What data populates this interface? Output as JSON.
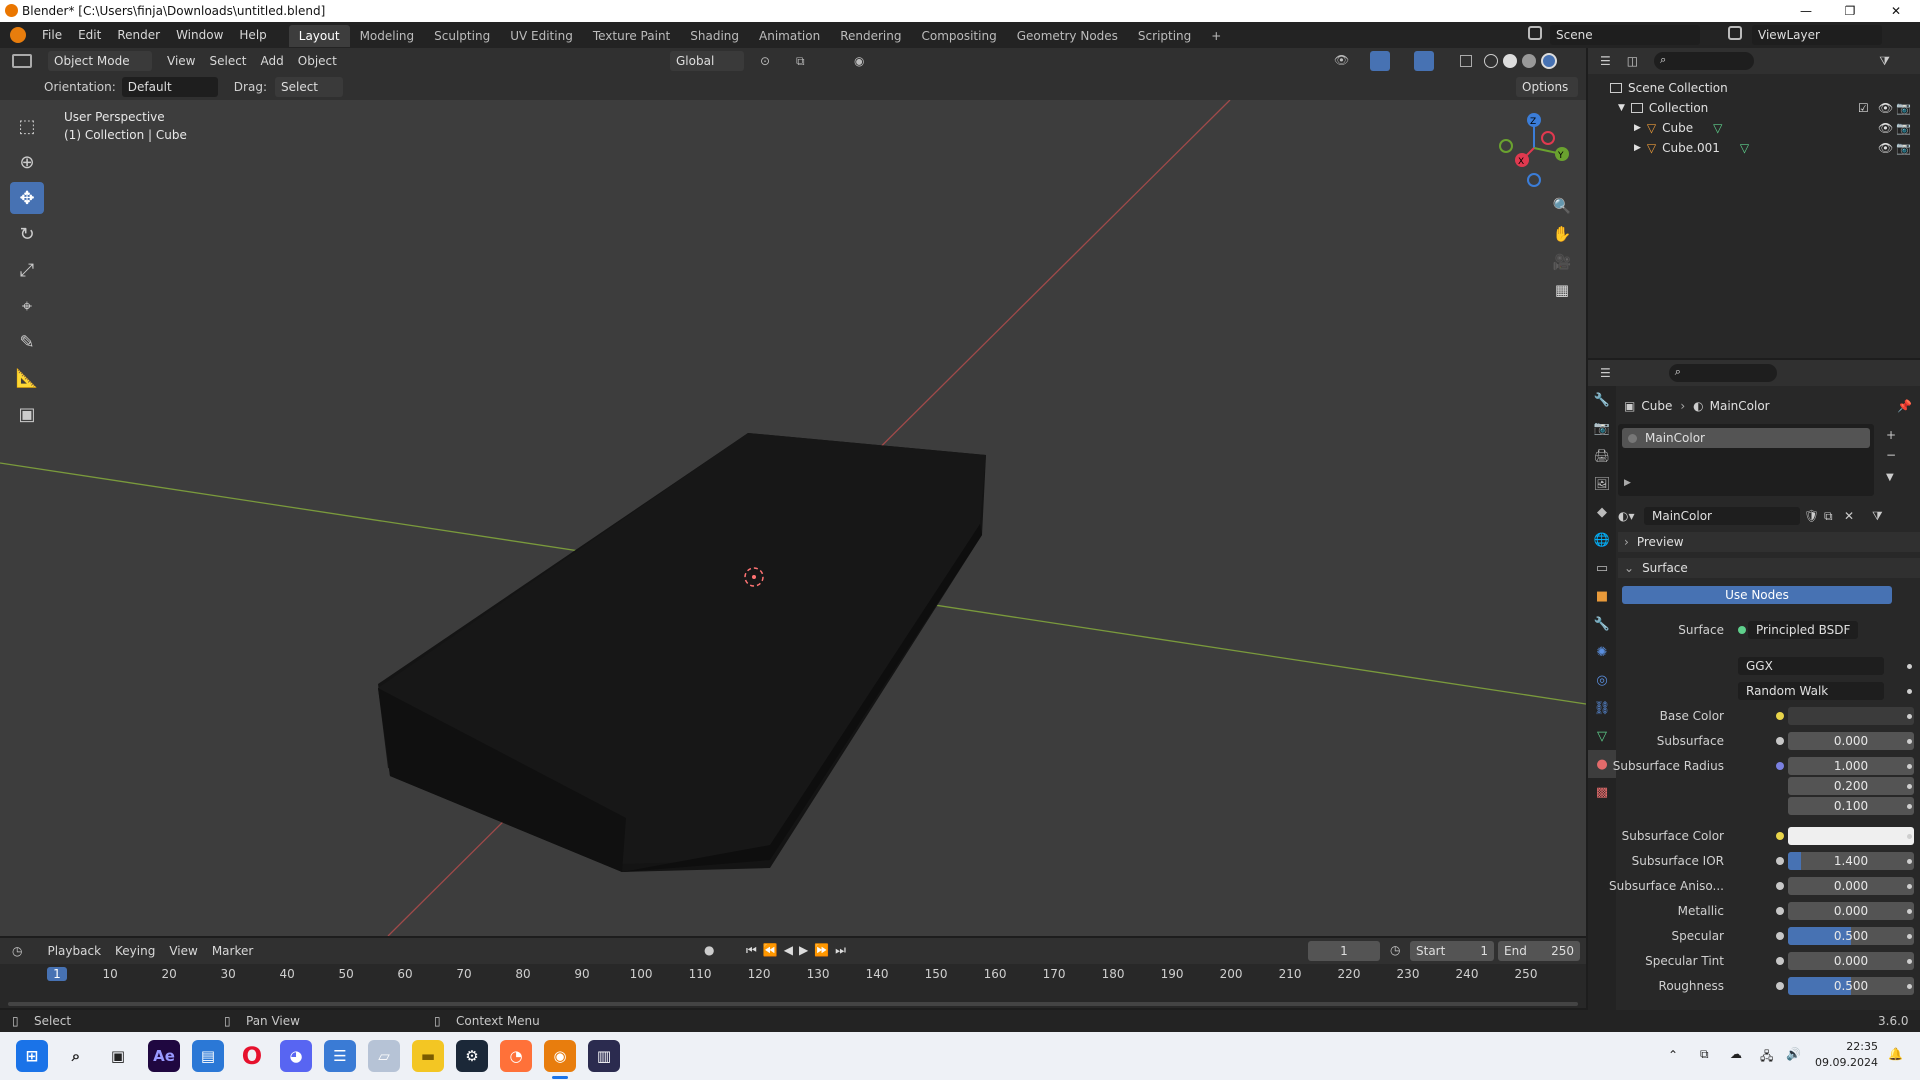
{
  "window": {
    "title": "Blender* [C:\\Users\\finja\\Downloads\\untitled.blend]",
    "minimize": "—",
    "maximize": "❐",
    "close": "✕"
  },
  "menu": {
    "file": "File",
    "edit": "Edit",
    "render": "Render",
    "window": "Window",
    "help": "Help"
  },
  "workspaces": [
    "Layout",
    "Modeling",
    "Sculpting",
    "UV Editing",
    "Texture Paint",
    "Shading",
    "Animation",
    "Rendering",
    "Compositing",
    "Geometry Nodes",
    "Scripting",
    "+"
  ],
  "scene": {
    "name": "Scene",
    "view_layer": "ViewLayer"
  },
  "viewport_header": {
    "mode": "Object Mode",
    "view": "View",
    "select": "Select",
    "add": "Add",
    "object": "Object",
    "transform": "Global"
  },
  "tool_settings": {
    "orientation_label": "Orientation:",
    "orientation_value": "Default",
    "drag_label": "Drag:",
    "drag_value": "Select Box",
    "options": "Options"
  },
  "viewport": {
    "perspective": "User Perspective",
    "collection": "(1) Collection | Cube"
  },
  "gizmo": {
    "x": "X",
    "y": "Y",
    "z": "Z"
  },
  "outliner": {
    "scene_collection": "Scene Collection",
    "collection": "Collection",
    "objects": [
      "Cube",
      "Cube.001"
    ]
  },
  "properties": {
    "breadcrumb_object": "Cube",
    "breadcrumb_material": "MainColor",
    "slot": "MainColor",
    "material_name": "MainColor",
    "preview": "Preview",
    "surface_panel": "Surface",
    "use_nodes": "Use Nodes",
    "surface_label": "Surface",
    "surface_value": "Principled BSDF",
    "distribution": "GGX",
    "subsurface_method": "Random Walk",
    "rows": [
      {
        "label": "Base Color",
        "value": "",
        "type": "color",
        "color": "#3b3b3b"
      },
      {
        "label": "Subsurface",
        "value": "0.000",
        "type": "num",
        "fill": 0
      },
      {
        "label": "Subsurface Radius",
        "value": "1.000",
        "type": "num",
        "fill": 0
      },
      {
        "label": "",
        "value": "0.200",
        "type": "num",
        "fill": 0
      },
      {
        "label": "",
        "value": "0.100",
        "type": "num",
        "fill": 0
      },
      {
        "label": "Subsurface Color",
        "value": "",
        "type": "color",
        "color": "#efefef"
      },
      {
        "label": "Subsurface IOR",
        "value": "1.400",
        "type": "num",
        "fill": 0.1
      },
      {
        "label": "Subsurface Aniso...",
        "value": "0.000",
        "type": "num",
        "fill": 0
      },
      {
        "label": "Metallic",
        "value": "0.000",
        "type": "num",
        "fill": 0
      },
      {
        "label": "Specular",
        "value": "0.500",
        "type": "num",
        "fill": 0.5
      },
      {
        "label": "Specular Tint",
        "value": "0.000",
        "type": "num",
        "fill": 0
      },
      {
        "label": "Roughness",
        "value": "0.500",
        "type": "num",
        "fill": 0.5
      }
    ]
  },
  "timeline": {
    "playback": "Playback",
    "keying": "Keying",
    "view": "View",
    "marker": "Marker",
    "current_frame": "1",
    "start_label": "Start",
    "start": "1",
    "end_label": "End",
    "end": "250",
    "ticks": [
      "1",
      "10",
      "20",
      "30",
      "40",
      "50",
      "60",
      "70",
      "80",
      "90",
      "100",
      "110",
      "120",
      "130",
      "140",
      "150",
      "160",
      "170",
      "180",
      "190",
      "200",
      "210",
      "220",
      "230",
      "240",
      "250"
    ]
  },
  "statusbar": {
    "select": "Select",
    "pan": "Pan View",
    "context": "Context Menu",
    "version": "3.6.0"
  },
  "taskbar": {
    "time": "22:35",
    "date": "09.09.2024",
    "ae_label": "Ae"
  }
}
